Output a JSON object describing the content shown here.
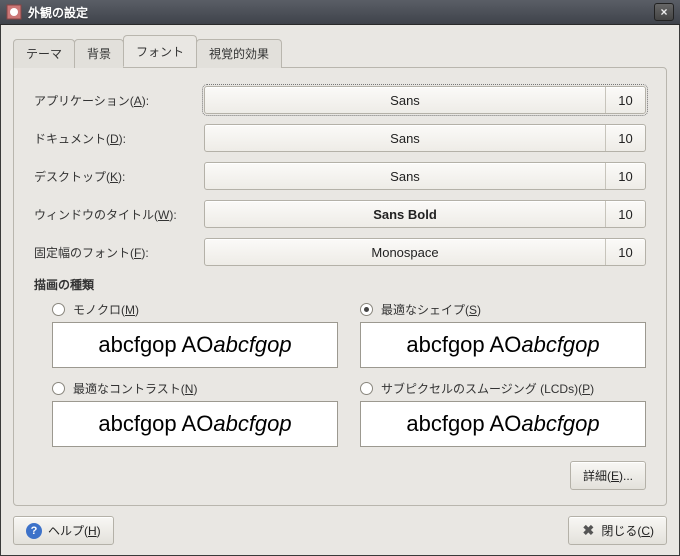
{
  "window": {
    "title": "外観の設定"
  },
  "tabs": [
    {
      "label": "テーマ"
    },
    {
      "label": "背景"
    },
    {
      "label": "フォント"
    },
    {
      "label": "視覚的効果"
    }
  ],
  "active_tab_index": 2,
  "font_rows": {
    "app": {
      "label_pre": "アプリケーション(",
      "mn": "A",
      "label_post": "):",
      "name": "Sans",
      "size": "10",
      "bold": false,
      "selected": true
    },
    "doc": {
      "label_pre": "ドキュメント(",
      "mn": "D",
      "label_post": "):",
      "name": "Sans",
      "size": "10",
      "bold": false,
      "selected": false
    },
    "desk": {
      "label_pre": "デスクトップ(",
      "mn": "K",
      "label_post": "):",
      "name": "Sans",
      "size": "10",
      "bold": false,
      "selected": false
    },
    "title": {
      "label_pre": "ウィンドウのタイトル(",
      "mn": "W",
      "label_post": "):",
      "name": "Sans Bold",
      "size": "10",
      "bold": true,
      "selected": false
    },
    "mono": {
      "label_pre": "固定幅のフォント(",
      "mn": "F",
      "label_post": "):",
      "name": "Monospace",
      "size": "10",
      "bold": false,
      "selected": false
    }
  },
  "render": {
    "heading": "描画の種類",
    "options": {
      "mono": {
        "label_pre": "モノクロ(",
        "mn": "M",
        "label_post": ")",
        "checked": false
      },
      "shape": {
        "label_pre": "最適なシェイプ(",
        "mn": "S",
        "label_post": ")",
        "checked": true
      },
      "contrast": {
        "label_pre": "最適なコントラスト(",
        "mn": "N",
        "label_post": ")",
        "checked": false
      },
      "subpixel": {
        "label_pre": "サブピクセルのスムージング (LCDs)(",
        "mn": "P",
        "label_post": ")",
        "checked": false
      }
    },
    "sample_plain": "abcfgop AO ",
    "sample_italic": "abcfgop"
  },
  "details_button": {
    "pre": "詳細(",
    "mn": "E",
    "post": ")..."
  },
  "footer": {
    "help": {
      "pre": "ヘルプ(",
      "mn": "H",
      "post": ")"
    },
    "close": {
      "pre": "閉じる(",
      "mn": "C",
      "post": ")"
    }
  }
}
